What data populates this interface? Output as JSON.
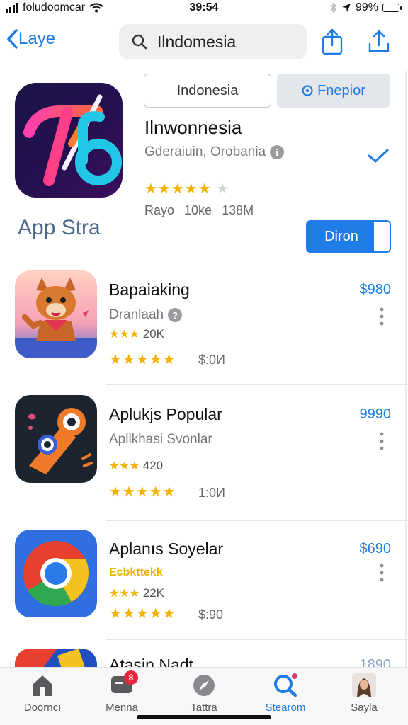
{
  "status": {
    "carrier": "foludoomcar",
    "time": "39:54",
    "battery": "99%"
  },
  "nav": {
    "back_label": "Laye",
    "search_value": "Ilndomesia"
  },
  "featured": {
    "caption": "App Stra",
    "segment_a": "Indonesia",
    "segment_b": "Fnepior",
    "title": "Ilnwonnesia",
    "subtitle": "Gderaiuin, Orobania",
    "rating_fraction": 0.8,
    "meta": [
      "Rayo",
      "10ke",
      "138M"
    ],
    "get_label": "Diron"
  },
  "apps": [
    {
      "name": "Bapaiaking",
      "price": "$980",
      "subtitle": "Dranlaah",
      "rating_count": "20K",
      "size": "$:0И",
      "icon": "fox-mascot-icon"
    },
    {
      "name": "Aplukjs Popular",
      "price": "9990",
      "subtitle": "Apllkhasi  Svonlar",
      "rating_count": "420",
      "size": "1:0И",
      "icon": "abstract-character-icon"
    },
    {
      "name": "Aplanıs Soyelar",
      "price": "$690",
      "subtitle": "Ecbkttekk",
      "rating_count": "22K",
      "size": "$:90",
      "icon": "chrome-logo-icon"
    },
    {
      "name": "Atasin Nadt",
      "price": "1890",
      "icon": "partial-app-icon"
    }
  ],
  "tabs": [
    {
      "label": "Doorncı",
      "icon": "home-icon"
    },
    {
      "label": "Menna",
      "icon": "messages-icon",
      "badge": "8"
    },
    {
      "label": "Tattra",
      "icon": "compass-icon"
    },
    {
      "label": "Stearom",
      "icon": "search-tab-icon"
    },
    {
      "label": "Sayla",
      "icon": "profile-avatar-icon"
    }
  ],
  "colors": {
    "accent": "#1e7ce6",
    "star": "#f5b301",
    "badge": "#e5263b"
  }
}
